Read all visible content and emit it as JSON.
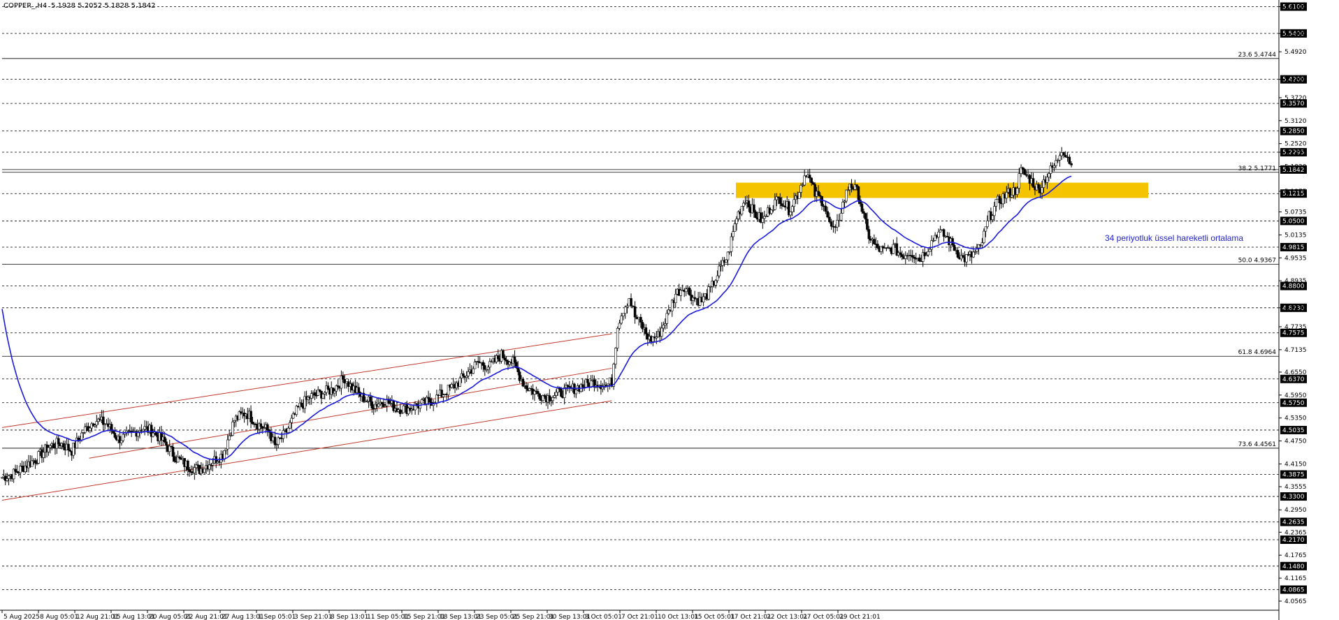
{
  "header": {
    "symbol": "COPPER_,H4",
    "ohlc": "5.1928 5.2052 5.1828 5.1842"
  },
  "chart_data": {
    "type": "candlestick",
    "symbol": "COPPER_",
    "timeframe": "H4",
    "grid": false,
    "ylim": [
      4.04,
      5.62
    ],
    "x_ticks": [
      "5 Aug 2025",
      "8 Aug 05:01",
      "12 Aug 21:01",
      "15 Aug 13:01",
      "20 Aug 05:01",
      "22 Aug 21:01",
      "27 Aug 13:01",
      "1 Sep 05:01",
      "3 Sep 21:01",
      "8 Sep 13:01",
      "11 Sep 05:01",
      "15 Sep 21:01",
      "18 Sep 13:01",
      "23 Sep 05:01",
      "25 Sep 21:01",
      "30 Sep 13:01",
      "3 Oct 05:01",
      "7 Oct 21:01",
      "10 Oct 13:01",
      "15 Oct 05:01",
      "17 Oct 21:01",
      "22 Oct 13:01",
      "27 Oct 05:01",
      "29 Oct 21:01"
    ],
    "y_ticks": [
      "5.6100",
      "5.5400",
      "5.4920",
      "5.4200",
      "5.3720",
      "5.3120",
      "5.2520",
      "5.2295",
      "5.1920",
      "5.1275",
      "5.0735",
      "5.0135",
      "4.9535",
      "4.8935",
      "4.8230",
      "4.7735",
      "4.7135",
      "4.6550",
      "4.5950",
      "4.5350",
      "4.4750",
      "4.4150",
      "4.3555",
      "4.2950",
      "4.2365",
      "4.1765",
      "4.1165",
      "4.0565"
    ],
    "price_levels": [
      "5.6100",
      "5.5400",
      "5.4200",
      "5.3570",
      "5.2850",
      "5.2295",
      "5.1842",
      "5.1215",
      "5.0500",
      "4.9815",
      "4.8800",
      "4.8230",
      "4.7575",
      "4.6370",
      "4.5750",
      "4.5035",
      "4.3875",
      "4.3300",
      "4.2635",
      "4.2170",
      "4.1480",
      "4.0865"
    ],
    "current_price": "5.1842",
    "fibonacci": [
      {
        "label": "23.6 5.4744",
        "value": 5.4744
      },
      {
        "label": "38.2 5.1771",
        "value": 5.1771
      },
      {
        "label": "50.0 4.9367",
        "value": 4.9367
      },
      {
        "label": "61.8 4.6964",
        "value": 4.6964
      },
      {
        "label": "73.6 4.4561",
        "value": 4.4561
      }
    ],
    "resistance_zone": {
      "from": 5.11,
      "to": 5.15,
      "color": "#f5c400"
    },
    "ema": {
      "name": "34 periyotluk üssel hareketli ortalama",
      "period": 34,
      "color": "#1a1adb"
    },
    "channel": {
      "color": "#c0392b",
      "lines": [
        {
          "start": [
            0,
            4.51
          ],
          "end": [
            420,
            4.755
          ]
        },
        {
          "start": [
            0,
            4.32
          ],
          "end": [
            420,
            4.58
          ]
        },
        {
          "start": [
            60,
            4.43
          ],
          "end": [
            420,
            4.665
          ]
        }
      ]
    },
    "annotation": "34 periyotluk üssel hareketli ortalama",
    "series": [
      {
        "name": "COPPER_",
        "close_path": [
          [
            0,
            4.38
          ],
          [
            8,
            4.39
          ],
          [
            16,
            4.41
          ],
          [
            24,
            4.43
          ],
          [
            32,
            4.46
          ],
          [
            40,
            4.47
          ],
          [
            48,
            4.45
          ],
          [
            56,
            4.5
          ],
          [
            64,
            4.53
          ],
          [
            72,
            4.52
          ],
          [
            80,
            4.48
          ],
          [
            88,
            4.49
          ],
          [
            96,
            4.51
          ],
          [
            104,
            4.5
          ],
          [
            112,
            4.47
          ],
          [
            120,
            4.43
          ],
          [
            128,
            4.41
          ],
          [
            136,
            4.4
          ],
          [
            144,
            4.42
          ],
          [
            152,
            4.44
          ],
          [
            160,
            4.53
          ],
          [
            168,
            4.55
          ],
          [
            176,
            4.52
          ],
          [
            184,
            4.5
          ],
          [
            188,
            4.46
          ],
          [
            196,
            4.5
          ],
          [
            204,
            4.56
          ],
          [
            212,
            4.59
          ],
          [
            220,
            4.6
          ],
          [
            228,
            4.61
          ],
          [
            236,
            4.64
          ],
          [
            240,
            4.62
          ],
          [
            248,
            4.59
          ],
          [
            256,
            4.57
          ],
          [
            264,
            4.58
          ],
          [
            272,
            4.56
          ],
          [
            280,
            4.56
          ],
          [
            288,
            4.57
          ],
          [
            296,
            4.58
          ],
          [
            304,
            4.6
          ],
          [
            312,
            4.62
          ],
          [
            320,
            4.65
          ],
          [
            328,
            4.68
          ],
          [
            336,
            4.67
          ],
          [
            344,
            4.7
          ],
          [
            352,
            4.68
          ],
          [
            360,
            4.62
          ],
          [
            368,
            4.6
          ],
          [
            376,
            4.59
          ],
          [
            384,
            4.6
          ],
          [
            392,
            4.61
          ],
          [
            400,
            4.62
          ],
          [
            408,
            4.63
          ],
          [
            416,
            4.62
          ],
          [
            420,
            4.63
          ],
          [
            424,
            4.78
          ],
          [
            428,
            4.82
          ],
          [
            432,
            4.85
          ],
          [
            436,
            4.8
          ],
          [
            440,
            4.78
          ],
          [
            446,
            4.74
          ],
          [
            452,
            4.75
          ],
          [
            458,
            4.8
          ],
          [
            464,
            4.86
          ],
          [
            470,
            4.88
          ],
          [
            476,
            4.85
          ],
          [
            482,
            4.84
          ],
          [
            488,
            4.87
          ],
          [
            494,
            4.92
          ],
          [
            500,
            4.96
          ],
          [
            506,
            5.06
          ],
          [
            512,
            5.11
          ],
          [
            518,
            5.07
          ],
          [
            524,
            5.05
          ],
          [
            530,
            5.09
          ],
          [
            536,
            5.11
          ],
          [
            542,
            5.08
          ],
          [
            548,
            5.12
          ],
          [
            554,
            5.18
          ],
          [
            560,
            5.12
          ],
          [
            566,
            5.1
          ],
          [
            570,
            5.04
          ],
          [
            574,
            5.02
          ],
          [
            578,
            5.08
          ],
          [
            584,
            5.15
          ],
          [
            590,
            5.12
          ],
          [
            596,
            5.02
          ],
          [
            602,
            4.98
          ],
          [
            608,
            4.97
          ],
          [
            614,
            4.98
          ],
          [
            620,
            4.96
          ],
          [
            626,
            4.97
          ],
          [
            632,
            4.95
          ],
          [
            638,
            4.98
          ],
          [
            644,
            5.02
          ],
          [
            650,
            5.01
          ],
          [
            656,
            4.98
          ],
          [
            662,
            4.95
          ],
          [
            668,
            4.96
          ],
          [
            674,
            4.98
          ],
          [
            680,
            5.06
          ],
          [
            686,
            5.1
          ],
          [
            692,
            5.12
          ],
          [
            698,
            5.13
          ],
          [
            702,
            5.18
          ],
          [
            708,
            5.16
          ],
          [
            714,
            5.13
          ],
          [
            720,
            5.17
          ],
          [
            726,
            5.2
          ],
          [
            730,
            5.24
          ],
          [
            734,
            5.22
          ],
          [
            738,
            5.18
          ]
        ]
      }
    ]
  }
}
